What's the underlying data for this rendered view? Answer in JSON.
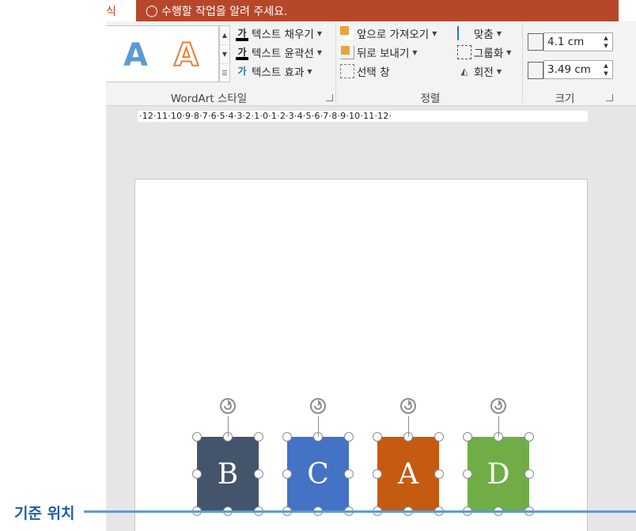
{
  "title_bar": {
    "partial_tab_label": "식",
    "tell_me": "수행할 작업을 알려 주세요."
  },
  "wordart": {
    "sample_letter_1": "A",
    "sample_letter_2": "A",
    "text_fill": "텍스트 채우기",
    "text_outline": "텍스트 윤곽선",
    "text_effects": "텍스트 효과",
    "group_label": "WordArt 스타일",
    "icon_glyph_fill": "가",
    "icon_glyph_outline": "가",
    "icon_glyph_effect": "가"
  },
  "arrange": {
    "bring_forward": "앞으로 가져오기",
    "send_backward": "뒤로 보내기",
    "selection_pane": "선택 창",
    "align": "맞춤",
    "group": "그룹화",
    "rotate": "회전",
    "group_label": "정렬"
  },
  "size": {
    "height": "4.1 cm",
    "width": "3.49 cm",
    "group_label": "크기"
  },
  "ruler": {
    "ticks": "·12·11·10·9·8·7·6·5·4·3·2·1·0·1·2·3·4·5·6·7·8·9·10·11·12·"
  },
  "slide": {
    "shapes": [
      {
        "label": "B",
        "color": "#44546a"
      },
      {
        "label": "C",
        "color": "#4472c4"
      },
      {
        "label": "A",
        "color": "#c55a11"
      },
      {
        "label": "D",
        "color": "#70ad47"
      }
    ]
  },
  "annotation": {
    "reference_label": "기준 위치",
    "line_color": "#5b9bd5"
  },
  "colors": {
    "tell_me_bg": "#b7472a",
    "wordart_blue": "#5b9bd5",
    "wordart_orange": "#ed7d31"
  }
}
